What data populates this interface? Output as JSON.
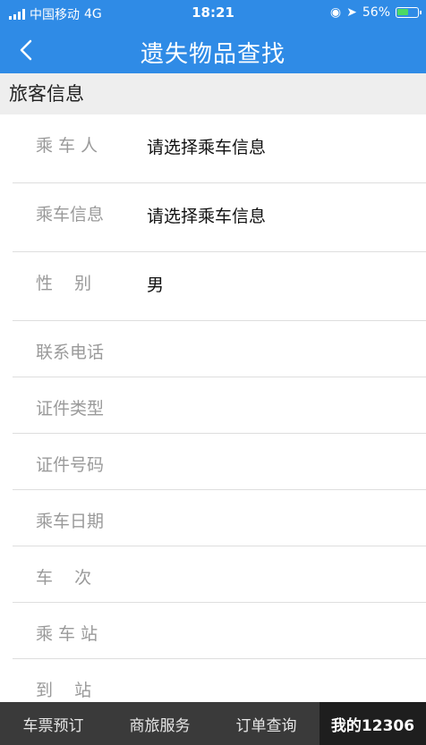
{
  "status_bar": {
    "carrier": "中国移动",
    "network": "4G",
    "time": "18:21",
    "battery_percent": "56%",
    "battery_level": 0.56
  },
  "nav": {
    "back_icon": "chevron-left-icon",
    "title": "遗失物品查找"
  },
  "section": {
    "title": "旅客信息"
  },
  "form": {
    "rows": [
      {
        "label": "乘 车 人",
        "value": "请选择乘车信息"
      },
      {
        "label": "乘车信息",
        "value": "请选择乘车信息"
      },
      {
        "label": "性    别",
        "value": "男"
      },
      {
        "label": "联系电话",
        "value": ""
      },
      {
        "label": "证件类型",
        "value": ""
      },
      {
        "label": "证件号码",
        "value": ""
      },
      {
        "label": "乘车日期",
        "value": ""
      },
      {
        "label": "车    次",
        "value": ""
      },
      {
        "label": "乘 车 站",
        "value": ""
      },
      {
        "label": "到    站",
        "value": ""
      }
    ]
  },
  "tabs": [
    {
      "label": "车票预订"
    },
    {
      "label": "商旅服务"
    },
    {
      "label": "订单查询"
    },
    {
      "label": "我的12306"
    }
  ],
  "colors": {
    "brand_blue": "#2f8be6",
    "tab_bar": "#3a3a3a",
    "tab_active": "#1e1e1e"
  }
}
